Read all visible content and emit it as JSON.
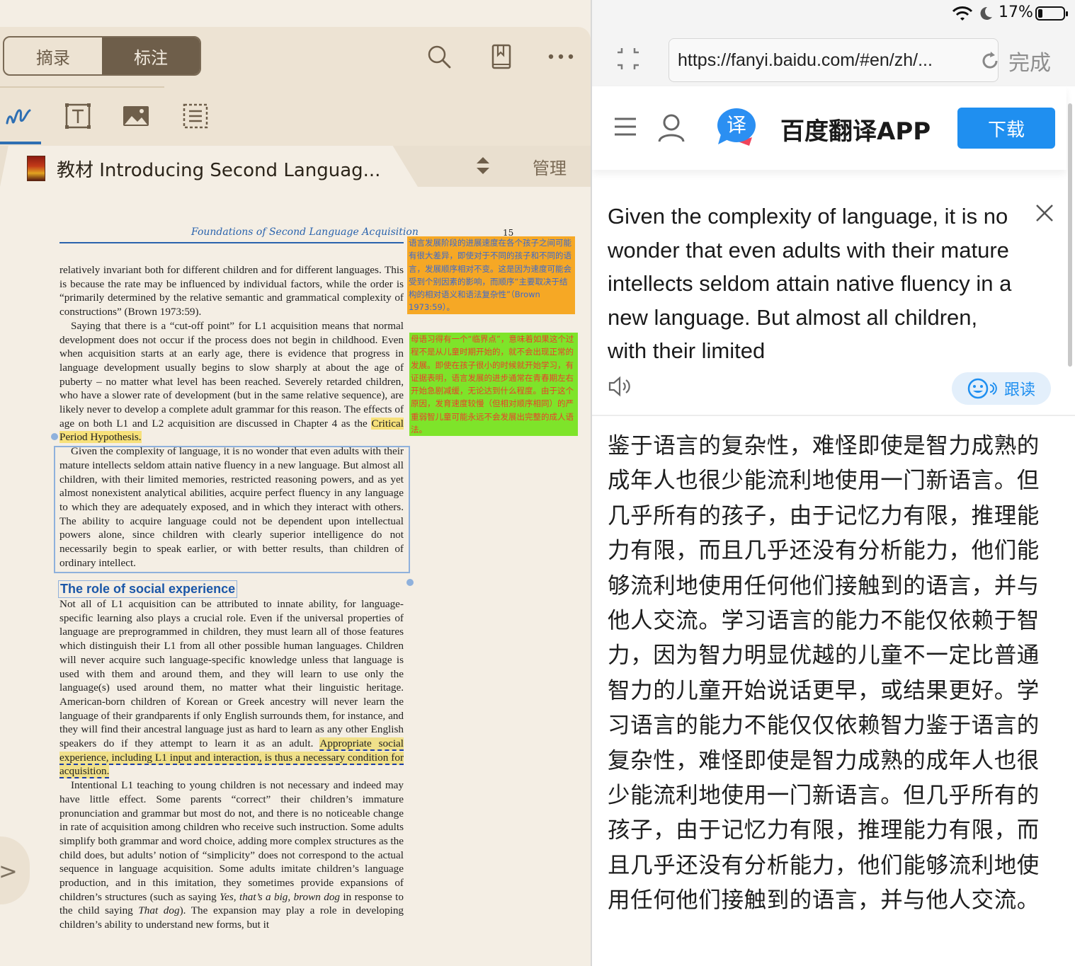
{
  "reader": {
    "segment": {
      "excerpt_label": "摘录",
      "annotate_label": "标注",
      "active": "标注"
    },
    "toolbar_icons": [
      "search-icon",
      "bookmark-icon",
      "more-icon"
    ],
    "annotation_tabs": [
      "handwriting-icon",
      "text-box-icon",
      "image-icon",
      "list-icon"
    ],
    "book_title": "教材 Introducing Second Languag...",
    "manage_label": "管理",
    "page": {
      "running_head": "Foundations of Second Language Acquisition",
      "page_number": "15",
      "para1": "relatively invariant both for different children and for different languages. This is because the rate may be influenced by individual factors, while the order is “primarily determined by the relative semantic and grammatical complexity of constructions” (Brown 1973:59).",
      "para2_start": "Saying that there is a “cut-off point” for L1 acquisition means that normal development does not occur if the process does not begin in childhood. Even when acquisition starts at an early age, there is evidence that progress in language development usually begins to slow sharply at about the age of puberty – no matter what level has been reached. Severely retarded children, who have a slower rate of development (but in the same relative sequence), are likely never to develop a complete adult grammar for this reason. The effects of age on both L1 and L2 acquisition are discussed in Chapter 4 as the ",
      "para2_highlight": "Critical Period Hypothesis.",
      "para3": "Given the complexity of language, it is no wonder that even adults with their mature intellects seldom attain native fluency in a new language. But almost all children, with their limited memories, restricted reasoning powers, and as yet almost nonexistent analytical abilities, acquire perfect fluency in any language to which they are adequately exposed, and in which they interact with others. The ability to acquire language could not be dependent upon intellectual powers alone, since children with clearly superior intelligence do not necessarily begin to speak earlier, or with better results, than children of ordinary intellect.",
      "section_heading": "The role of social experience",
      "para4_start": "Not all of L1 acquisition can be attributed to innate ability, for language-specific learning also plays a crucial role. Even if the universal properties of language are preprogrammed in children, they must learn all of those features which distinguish their L1 from all other possible human languages. Children will never acquire such language-specific knowledge unless that language is used with them and around them, and they will learn to use only the language(s) used around them, no matter what their linguistic heritage. American-born children of Korean or Greek ancestry will never learn the language of their grandparents if only English surrounds them, for instance, and they will find their ancestral language just as hard to learn as any other English speakers do if they attempt to learn it as an adult. ",
      "para4_highlight": "Appropriate social experience, including L1 input and interaction, is thus a necessary condition for acquisition.",
      "para5_start": "Intentional L1 teaching to young children is not necessary and indeed may have little effect. Some parents “correct” their children’s immature pronunciation and grammar but most do not, and there is no noticeable change in rate of acquisition among children who receive such instruction. Some adults simplify both grammar and word choice, adding more complex structures as the child does, but adults’ notion of “simplicity” does not correspond to the actual sequence in language acquisition. Some adults imitate children’s language production, and in this imitation, they sometimes provide expansions of children’s structures (such as saying ",
      "para5_italic1": "Yes, that’s a big, brown dog",
      "para5_mid": " in response to the child saying ",
      "para5_italic2": "That dog",
      "para5_end": "). The expansion may play a role in developing children’s ability to understand new forms, but it"
    },
    "notes": {
      "note1": "语言发展阶段的进展速度在各个孩子之间可能有很大差异，即使对于不同的孩子和不同的语言，发展顺序相对不变。这是因为速度可能会受到个别因素的影响，而顺序“主要取决于结构的相对语义和语法复杂性”（Brown 1973:59）。",
      "note2": "母语习得有一个“临界点”，意味着如果这个过程不是从儿童时期开始的，就不会出现正常的发展。即使在孩子很小的时候就开始学习，有证据表明，语言发展的进步通常在青春期左右开始急剧减缓，无论达到什么程度。由于这个原因，发育速度较慢（但相对顺序相同）的严重弱智儿童可能永远不会发展出完整的成人语法。",
      "note1_color": "#f6a825",
      "note2_color": "#7ee42a"
    }
  },
  "browser": {
    "status": {
      "battery_percent": "17%",
      "battery_level": 0.17
    },
    "url": "https://fanyi.baidu.com/#en/zh/...",
    "done_label": "完成",
    "app_banner": {
      "name": "百度翻译APP",
      "download_label": "下载",
      "logo_char": "译"
    },
    "source_text": "Given the complexity of language, it is no wonder that even adults with their mature intellects seldom attain native fluency in a new language. But almost all children, with their limited",
    "follow_read_label": "跟读",
    "translation": "鉴于语言的复杂性，难怪即使是智力成熟的成年人也很少能流利地使用一门新语言。但几乎所有的孩子，由于记忆力有限，推理能力有限，而且几乎还没有分析能力，他们能够流利地使用任何他们接触到的语言，并与他人交流。学习语言的能力不能仅依赖于智力，因为智力明显优越的儿童不一定比普通智力的儿童开始说话更早，或结果更好。学习语言的能力不能仅仅依赖智力鉴于语言的复杂性，难怪即使是智力成熟的成年人也很少能流利地使用一门新语言。但几乎所有的孩子，由于记忆力有限，推理能力有限，而且几乎还没有分析能力，他们能够流利地使用任何他们接触到的语言，并与他人交流。",
    "accent_color": "#1f8ff0"
  }
}
